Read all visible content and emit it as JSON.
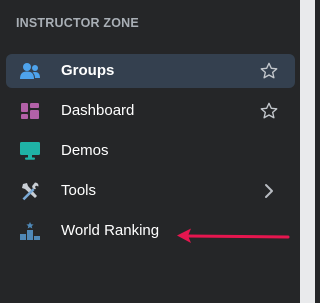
{
  "section": {
    "title": "INSTRUCTOR ZONE"
  },
  "nav": {
    "items": [
      {
        "label": "Groups",
        "icon": "users-icon",
        "active": true,
        "trailing": "star-outline-icon"
      },
      {
        "label": "Dashboard",
        "icon": "dashboard-grid-icon",
        "trailing": "star-outline-icon"
      },
      {
        "label": "Demos",
        "icon": "monitor-icon"
      },
      {
        "label": "Tools",
        "icon": "tools-icon",
        "trailing": "chevron-right-icon"
      },
      {
        "label": "World Ranking",
        "icon": "podium-icon"
      }
    ]
  },
  "colors": {
    "background": "#252628",
    "active_background": "#34404f",
    "groups_icon": "#4ea3ec",
    "dashboard_icon": "#b261a8",
    "demos_icon": "#1fb3a6",
    "tools_icon_handle": "#7aa9d6",
    "ranking_icon": "#4f88b7",
    "annotation_arrow": "#e5164f"
  }
}
